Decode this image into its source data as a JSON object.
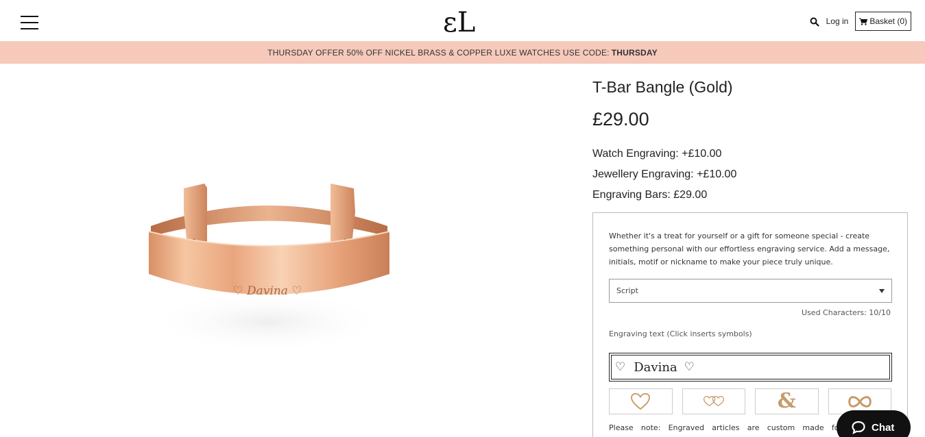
{
  "header": {
    "logo_text": "ɛL",
    "login_label": "Log in",
    "basket_label": "Basket (0)"
  },
  "promo": {
    "text": "THURSDAY OFFER 50% OFF NICKEL BRASS & COPPER LUXE WATCHES USE CODE:",
    "code": "THURSDAY"
  },
  "product": {
    "title": "T-Bar Bangle (Gold)",
    "price": "£29.00",
    "image_engraving": "♡ Davina ♡",
    "price_lines": [
      "Watch Engraving: +£10.00",
      "Jewellery Engraving: +£10.00",
      "Engraving Bars: £29.00"
    ]
  },
  "engraving": {
    "description": "Whether it's a treat for yourself or a gift for someone special - create something personal with our effortless engraving service. Add a message, initials, motif or nickname to make your piece truly unique.",
    "font_selected": "Script",
    "used_characters": "Used Characters: 10/10",
    "text_label": "Engraving text (Click inserts symbols)",
    "input_heart_left": "♡",
    "input_word": "Davina",
    "input_heart_right": "♡",
    "symbols": [
      "heart",
      "double-heart",
      "ampersand",
      "infinity"
    ],
    "symbol_amp": "&",
    "note_words": [
      "Please",
      "note:",
      "Engraved",
      "articles",
      "are",
      "custom",
      "made",
      "for"
    ]
  },
  "chat": {
    "label": "Chat"
  },
  "colors": {
    "promo_bg": "#f6c9bb",
    "rose_gold": "#e8a97f",
    "symbol": "#c89a6a"
  }
}
